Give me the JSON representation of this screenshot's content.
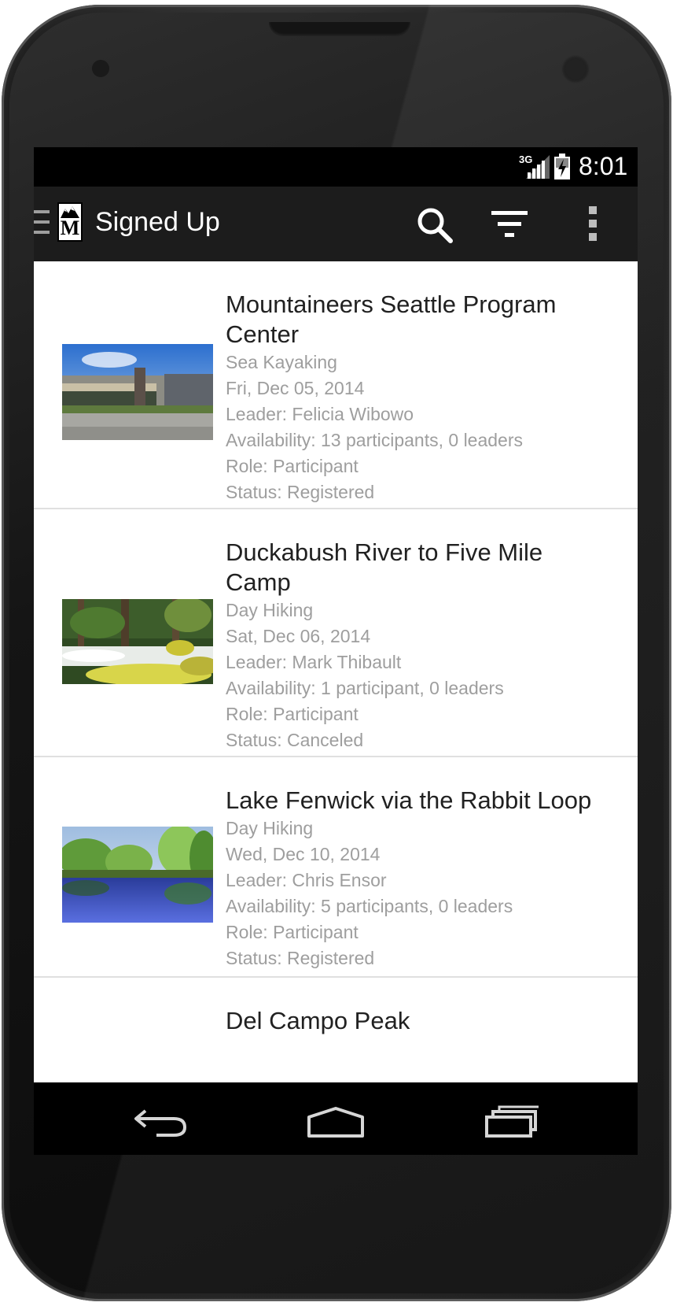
{
  "status_bar": {
    "network": "3G",
    "time": "8:01"
  },
  "action_bar": {
    "title": "Signed Up",
    "logo_letter": "M",
    "icons": [
      "navigation-drawer-icon",
      "search-icon",
      "filter-icon",
      "overflow-menu-icon"
    ]
  },
  "activities": [
    {
      "title_line1": "Mountaineers Seattle Program",
      "title_line2": "Center",
      "type": "Sea Kayaking",
      "date": "Fri, Dec 05, 2014",
      "leader": "Leader: Felicia Wibowo",
      "availability": "Availability: 13 participants, 0 leaders",
      "role": "Role: Participant",
      "status": "Status: Registered"
    },
    {
      "title_line1": "Duckabush River to Five Mile",
      "title_line2": "Camp",
      "type": "Day Hiking",
      "date": "Sat, Dec 06, 2014",
      "leader": "Leader: Mark Thibault",
      "availability": "Availability: 1 participant, 0 leaders",
      "role": "Role: Participant",
      "status": "Status: Canceled"
    },
    {
      "title_line1": "Lake Fenwick via the Rabbit Loop",
      "title_line2": "",
      "type": "Day Hiking",
      "date": "Wed, Dec 10, 2014",
      "leader": "Leader: Chris Ensor",
      "availability": "Availability: 5 participants, 0 leaders",
      "role": "Role: Participant",
      "status": "Status: Registered"
    },
    {
      "title_line1": "Del Campo Peak"
    }
  ],
  "nav_bar": {
    "icons": [
      "back-icon",
      "home-icon",
      "recent-apps-icon"
    ]
  },
  "colors": {
    "action_bar": "#1c1c1c",
    "title_text": "#212121",
    "meta_text": "#9e9e9e",
    "divider": "#e0e0e0"
  }
}
